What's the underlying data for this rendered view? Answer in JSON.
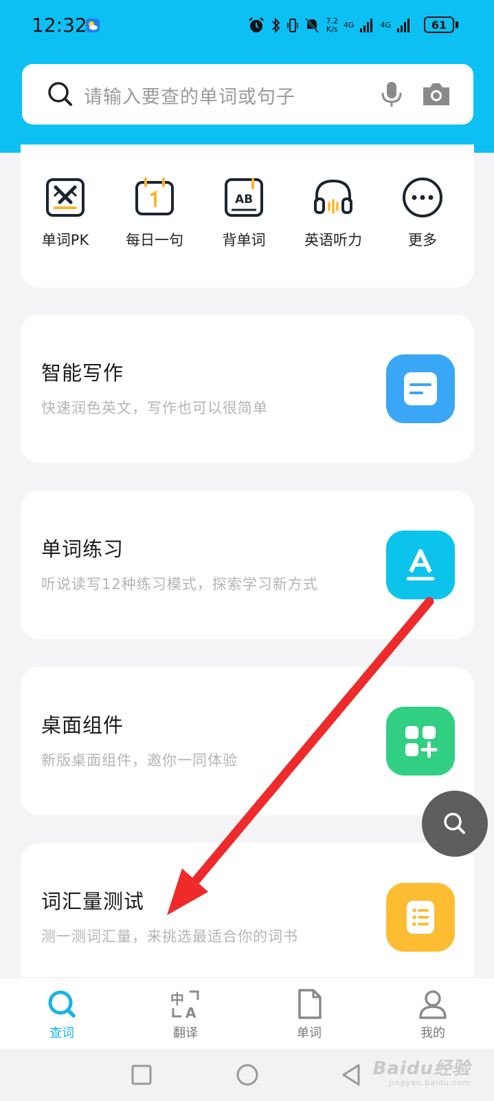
{
  "status_bar": {
    "time": "12:32",
    "speed_value": "7.2",
    "speed_unit": "K/s",
    "network_1": "4G",
    "network_2": "4G",
    "battery": "61"
  },
  "search": {
    "placeholder": "请输入要查的单词或句子"
  },
  "shortcuts": [
    {
      "label": "单词PK",
      "icon": "swords-icon"
    },
    {
      "label": "每日一句",
      "icon": "calendar-icon"
    },
    {
      "label": "背单词",
      "icon": "ab-book-icon"
    },
    {
      "label": "英语听力",
      "icon": "headphones-icon"
    },
    {
      "label": "更多",
      "icon": "more-icon"
    }
  ],
  "cards": [
    {
      "title": "智能写作",
      "subtitle": "快速润色英文，写作也可以很简单",
      "icon": "document-icon",
      "color": "#3aa6f6"
    },
    {
      "title": "单词练习",
      "subtitle": "听说读写12种练习模式，探索学习新方式",
      "icon": "letter-a-icon",
      "color": "#0cc3ec"
    },
    {
      "title": "桌面组件",
      "subtitle": "新版桌面组件，邀你一同体验",
      "icon": "widgets-icon",
      "color": "#31cf82"
    },
    {
      "title": "词汇量测试",
      "subtitle": "测一测词汇量，来挑选最适合你的词书",
      "icon": "list-icon",
      "color": "#fdbd33"
    }
  ],
  "tabs": [
    {
      "label": "查词",
      "icon": "search-icon",
      "active": true
    },
    {
      "label": "翻译",
      "icon": "translate-icon",
      "active": false
    },
    {
      "label": "单词",
      "icon": "file-icon",
      "active": false
    },
    {
      "label": "我的",
      "icon": "person-icon",
      "active": false
    }
  ],
  "watermark": {
    "main": "Baidu经验",
    "url": "jingyan.baidu.com"
  },
  "colors": {
    "header": "#0cc0f3",
    "accent": "#16b4e6",
    "arrow": "#ee2a2a"
  }
}
